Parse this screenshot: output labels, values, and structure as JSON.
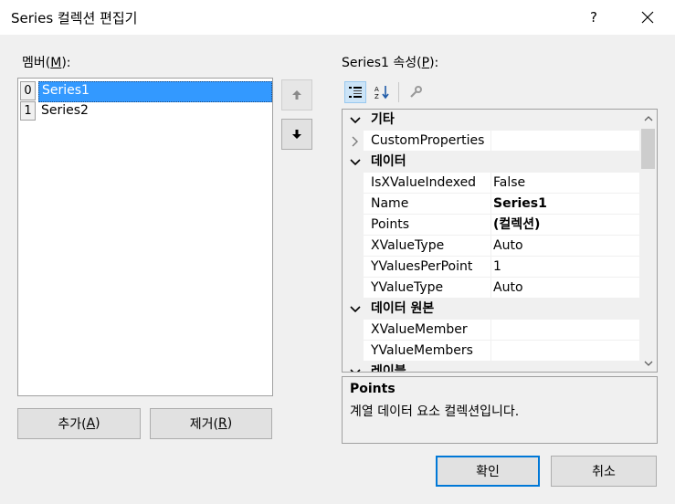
{
  "window": {
    "title": "Series 컬렉션 편집기",
    "help": "?"
  },
  "members": {
    "label_prefix": "멤버(",
    "label_key": "M",
    "label_suffix": "):",
    "items": [
      {
        "index": "0",
        "name": "Series1",
        "selected": true
      },
      {
        "index": "1",
        "name": "Series2",
        "selected": false
      }
    ]
  },
  "buttons": {
    "add_prefix": "추가(",
    "add_key": "A",
    "add_suffix": ")",
    "remove_prefix": "제거(",
    "remove_key": "R",
    "remove_suffix": ")",
    "ok": "확인",
    "cancel": "취소"
  },
  "properties": {
    "label_prefix": "Series1 속성(",
    "label_key": "P",
    "label_suffix": "):",
    "toolbar": [
      "categorized-icon",
      "alphabetical-icon",
      "property-pages-icon"
    ],
    "rows": [
      {
        "type": "category",
        "name": "기타"
      },
      {
        "type": "prop",
        "name": "CustomProperties",
        "value": "",
        "expandable": true
      },
      {
        "type": "category",
        "name": "데이터"
      },
      {
        "type": "prop",
        "name": "IsXValueIndexed",
        "value": "False"
      },
      {
        "type": "prop",
        "name": "Name",
        "value": "Series1",
        "bold": true
      },
      {
        "type": "prop",
        "name": "Points",
        "value": "(컬렉션)",
        "bold": true
      },
      {
        "type": "prop",
        "name": "XValueType",
        "value": "Auto"
      },
      {
        "type": "prop",
        "name": "YValuesPerPoint",
        "value": "1"
      },
      {
        "type": "prop",
        "name": "YValueType",
        "value": "Auto"
      },
      {
        "type": "category",
        "name": "데이터 원본"
      },
      {
        "type": "prop",
        "name": "XValueMember",
        "value": ""
      },
      {
        "type": "prop",
        "name": "YValueMembers",
        "value": ""
      },
      {
        "type": "category",
        "name": "레이블"
      }
    ]
  },
  "description": {
    "title": "Points",
    "text": "계열 데이터 요소 컬렉션입니다."
  }
}
